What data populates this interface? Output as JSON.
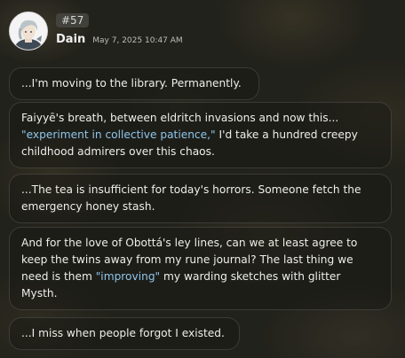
{
  "post": {
    "badge": "#57",
    "author": "Dain",
    "timestamp": "May 7, 2025 10:47 AM",
    "avatar_icon": "character-avatar-icon"
  },
  "messages": [
    {
      "parts": [
        "...I'm moving to the library. Permanently."
      ]
    },
    {
      "parts": [
        "Faiyyē's breath, between eldritch invasions and now this... ",
        "\"experiment in collective patience,\"",
        " I'd take a hundred creepy childhood admirers over this chaos."
      ]
    },
    {
      "parts": [
        "...The tea is insufficient for today's horrors. Someone fetch the emergency honey stash."
      ]
    },
    {
      "parts": [
        "And for the love of Obottá's ley lines, can we at least agree to keep the twins away from my rune journal? The last thing we need is them ",
        "\"improving\"",
        " my warding sketches with glitter Mysth."
      ]
    },
    {
      "parts": [
        "...I miss when people forgot I existed."
      ]
    }
  ],
  "colors": {
    "highlight": "#8ec6ea",
    "text": "#eeeeea"
  }
}
